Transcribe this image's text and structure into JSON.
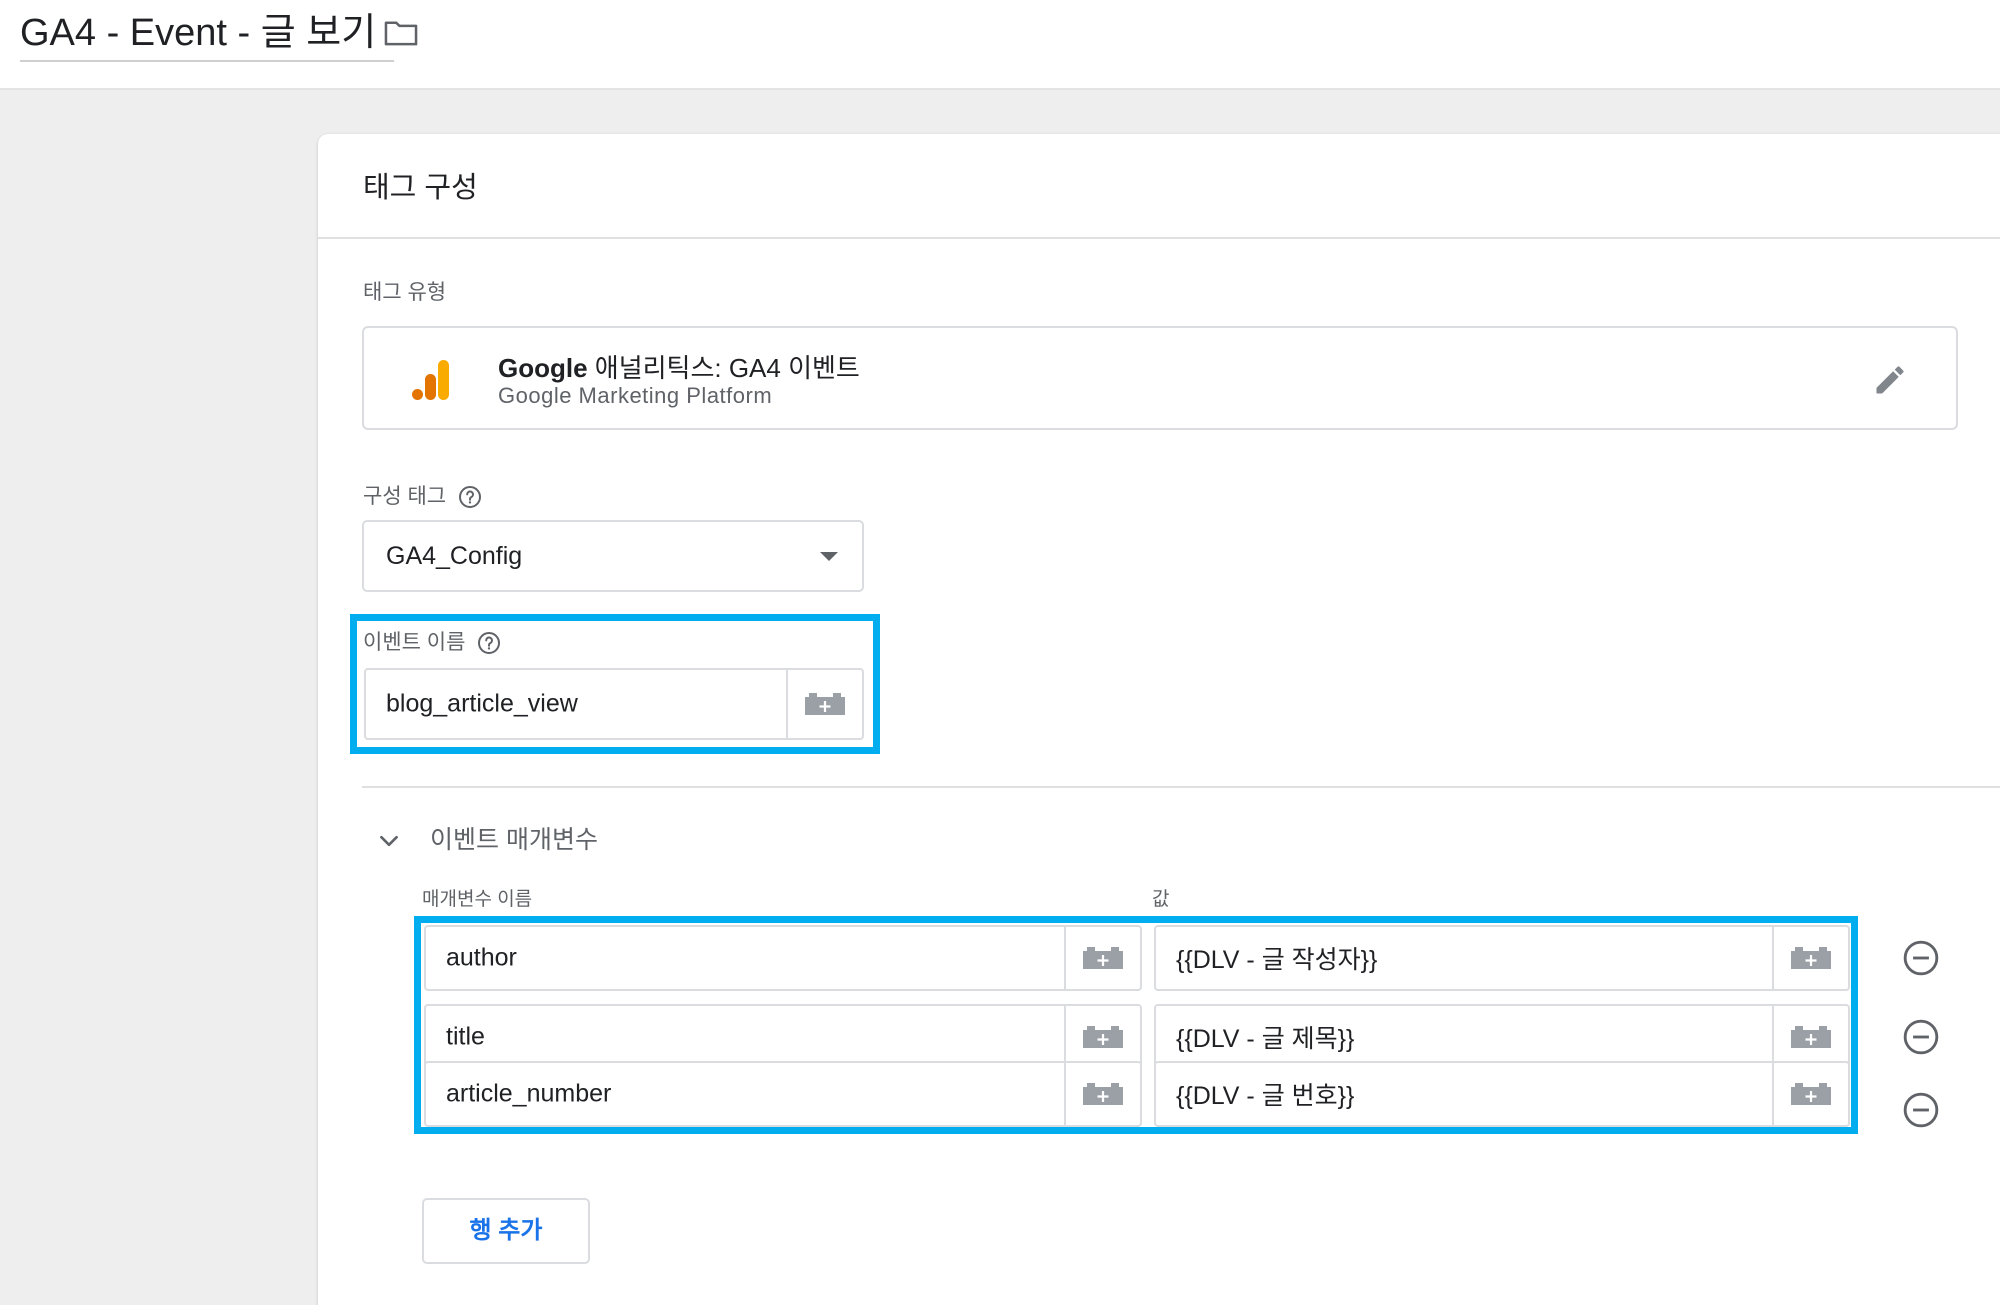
{
  "header": {
    "title": "GA4 - Event - 글 보기",
    "folder_icon": "folder-icon"
  },
  "card": {
    "title": "태그 구성",
    "tag_type": {
      "label": "태그 유형",
      "name_bold": "Google",
      "name_rest": " 애널리틱스: GA4 이벤트",
      "platform": "Google Marketing Platform",
      "logo_icon": "google-analytics-icon",
      "edit_icon": "pencil-icon"
    },
    "config_tag": {
      "label": "구성 태그",
      "value": "GA4_Config"
    },
    "event_name": {
      "label": "이벤트 이름",
      "value": "blog_article_view"
    },
    "event_params": {
      "title": "이벤트 매개변수",
      "col_name": "매개변수 이름",
      "col_value": "값",
      "rows": [
        {
          "name": "author",
          "value": "{{DLV - 글 작성자}}"
        },
        {
          "name": "title",
          "value": "{{DLV - 글 제목}}"
        },
        {
          "name": "article_number",
          "value": "{{DLV - 글 번호}}"
        }
      ],
      "add_row_label": "행 추가"
    },
    "highlight_color": "#00aeef",
    "accent_color": "#1a73e8"
  }
}
